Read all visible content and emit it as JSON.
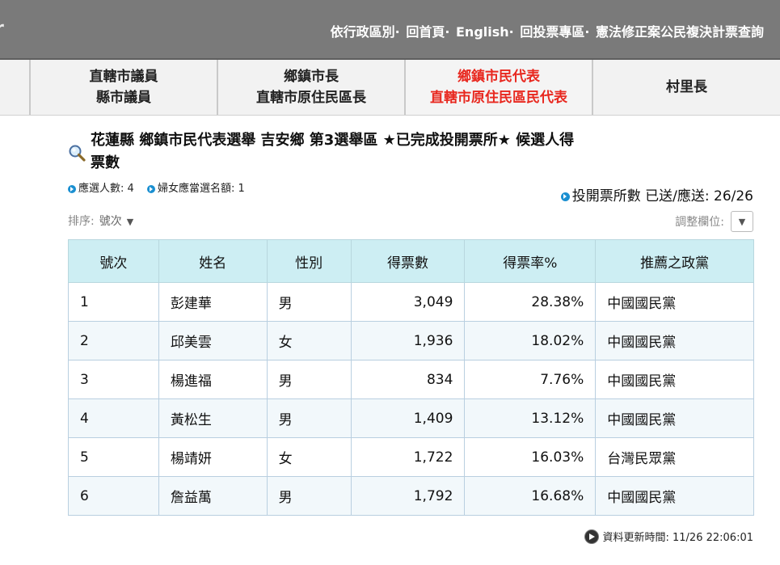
{
  "topbar": {
    "logo_fragment": "r",
    "links": [
      "依行政區別·",
      "回首頁·",
      "English·",
      "回投票專區·",
      "憲法修正案公民複決計票查詢"
    ]
  },
  "nav": {
    "items": [
      {
        "line1": "直轄市議員",
        "line2": "縣市議員",
        "active": false
      },
      {
        "line1": "鄉鎮市長",
        "line2": "直轄市原住民區長",
        "active": false
      },
      {
        "line1": "鄉鎮市民代表",
        "line2": "直轄市原住民區民代表",
        "active": true
      },
      {
        "line1": "村里長",
        "line2": "",
        "active": false
      }
    ]
  },
  "heading": {
    "title": "花蓮縣 鄉鎮市民代表選舉 吉安鄉 第3選舉區 ★已完成投開票所★ 候選人得票數"
  },
  "meta": {
    "seats": "應選人數: 4",
    "women_quota": "婦女應當選名額: 1",
    "stations": "投開票所數 已送/應送: 26/26"
  },
  "controls": {
    "sort_label": "排序:",
    "sort_value": "號次",
    "adjust_label": "調整欄位:"
  },
  "table": {
    "headers": [
      "號次",
      "姓名",
      "性別",
      "得票數",
      "得票率%",
      "推薦之政黨"
    ],
    "rows": [
      [
        "1",
        "彭建華",
        "男",
        "3,049",
        "28.38%",
        "中國國民黨"
      ],
      [
        "2",
        "邱美雲",
        "女",
        "1,936",
        "18.02%",
        "中國國民黨"
      ],
      [
        "3",
        "楊進福",
        "男",
        "834",
        "7.76%",
        "中國國民黨"
      ],
      [
        "4",
        "黃松生",
        "男",
        "1,409",
        "13.12%",
        "中國國民黨"
      ],
      [
        "5",
        "楊靖妍",
        "女",
        "1,722",
        "16.03%",
        "台灣民眾黨"
      ],
      [
        "6",
        "詹益萬",
        "男",
        "1,792",
        "16.68%",
        "中國國民黨"
      ]
    ]
  },
  "footer": {
    "updated": "資料更新時間: 11/26 22:06:01"
  },
  "colors": {
    "topbar": "#7a7a7a",
    "active_nav": "#e8281f",
    "table_header": "#cdeef3",
    "bullet": "#1a8fd1"
  }
}
